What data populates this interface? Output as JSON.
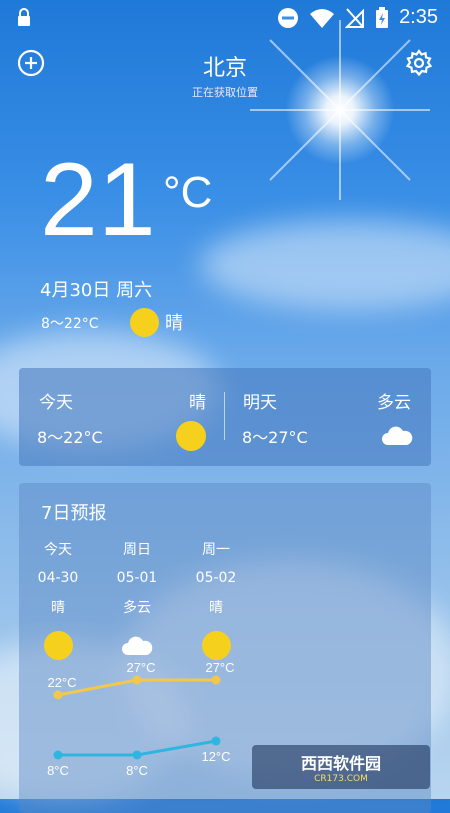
{
  "status_bar": {
    "time": "2:35"
  },
  "header": {
    "city": "北京",
    "locating": "正在获取位置"
  },
  "current": {
    "temperature": "21",
    "unit": "°C",
    "date": "4月30日 周六",
    "range": "8～22°C",
    "condition": "晴",
    "icon": "sun-icon"
  },
  "summary": {
    "today": {
      "label": "今天",
      "condition": "晴",
      "range": "8～22°C",
      "icon": "sun-icon"
    },
    "tomorrow": {
      "label": "明天",
      "condition": "多云",
      "range": "8～27°C",
      "icon": "cloud-icon"
    }
  },
  "forecast": {
    "title": "7日预报",
    "days": [
      {
        "day": "今天",
        "date": "04-30",
        "condition": "晴",
        "icon": "sun-icon",
        "high": "22°C",
        "low": "8°C"
      },
      {
        "day": "周日",
        "date": "05-01",
        "condition": "多云",
        "icon": "cloud-icon",
        "high": "27°C",
        "low": "8°C"
      },
      {
        "day": "周一",
        "date": "05-02",
        "condition": "晴",
        "icon": "sun-icon",
        "high": "27°C",
        "low": "12°C"
      }
    ],
    "high_values": [
      22,
      27,
      27
    ],
    "low_values": [
      8,
      8,
      12
    ],
    "colors": {
      "high_line": "#f2c84b",
      "low_line": "#2fb6e0"
    }
  },
  "watermark": {
    "brand": "西西软件园",
    "site": "CR173.COM"
  }
}
